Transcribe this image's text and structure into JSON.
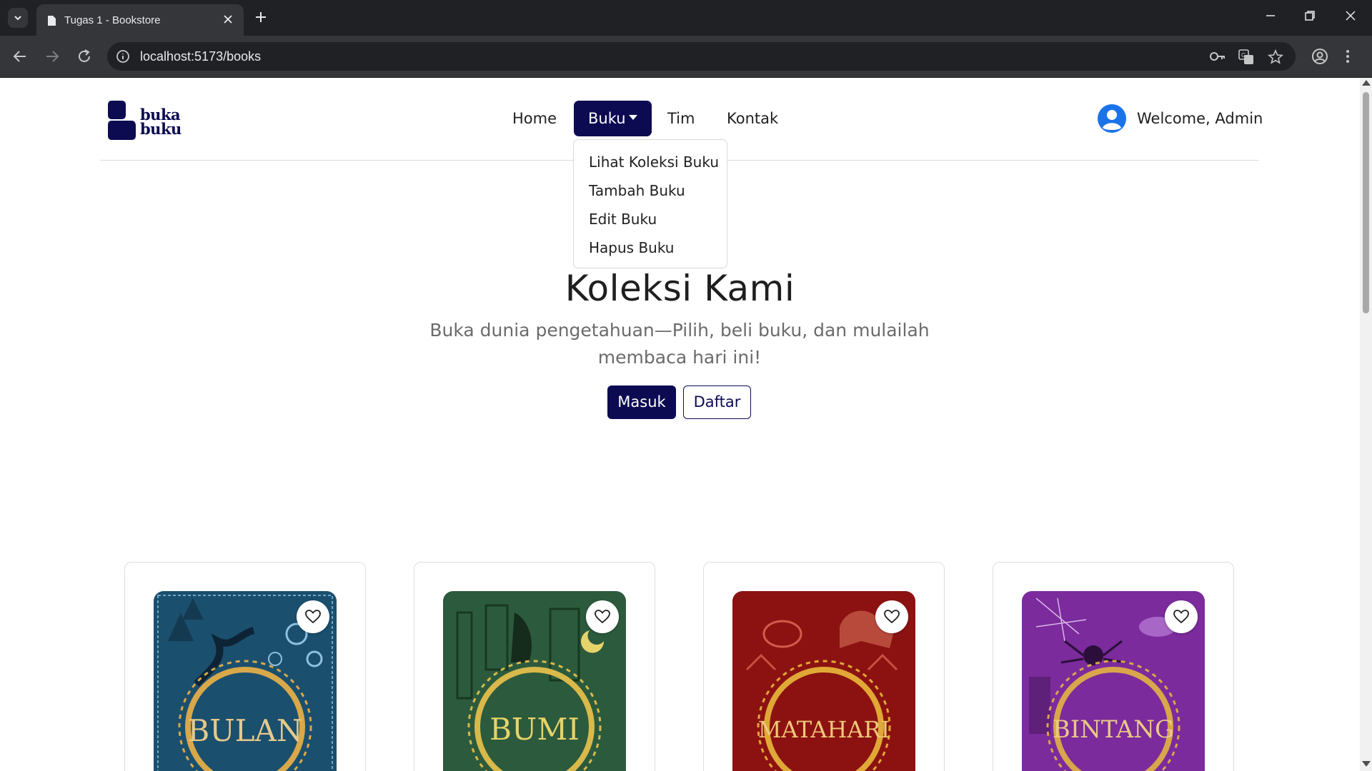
{
  "browser": {
    "tab_title": "Tugas 1 - Bookstore",
    "url": "localhost:5173/books",
    "icons": [
      "tab-search-icon",
      "page-icon",
      "close-icon",
      "plus-icon",
      "minimize-icon",
      "restore-icon",
      "close-window-icon",
      "back-icon",
      "forward-icon",
      "reload-icon",
      "info-icon",
      "key-icon",
      "translate-icon",
      "star-icon",
      "profile-icon",
      "menu-icon"
    ]
  },
  "brand": {
    "line1": "buka",
    "line2": "buku",
    "color": "#0c0b52"
  },
  "nav": {
    "home": "Home",
    "buku": "Buku",
    "tim": "Tim",
    "kontak": "Kontak"
  },
  "dropdown": {
    "items": [
      "Lihat Koleksi Buku",
      "Tambah Buku",
      "Edit Buku",
      "Hapus Buku"
    ]
  },
  "user": {
    "welcome": "Welcome, Admin",
    "avatar_color": "#1a73e8"
  },
  "hero": {
    "title": "Koleksi Kami",
    "subtitle": "Buka dunia pengetahuan—Pilih, beli buku, dan mulailah membaca hari ini!",
    "login_label": "Masuk",
    "register_label": "Daftar"
  },
  "books": [
    {
      "title": "BULAN",
      "color": "#1b4f6e",
      "accent": "#d8a84a"
    },
    {
      "title": "BUMI",
      "color": "#2c5a3d",
      "accent": "#d8b94a"
    },
    {
      "title": "MATAHARI",
      "color": "#8c1212",
      "accent": "#e0a836"
    },
    {
      "title": "BINTANG",
      "color": "#7b2b9c",
      "accent": "#d9a64b"
    }
  ]
}
